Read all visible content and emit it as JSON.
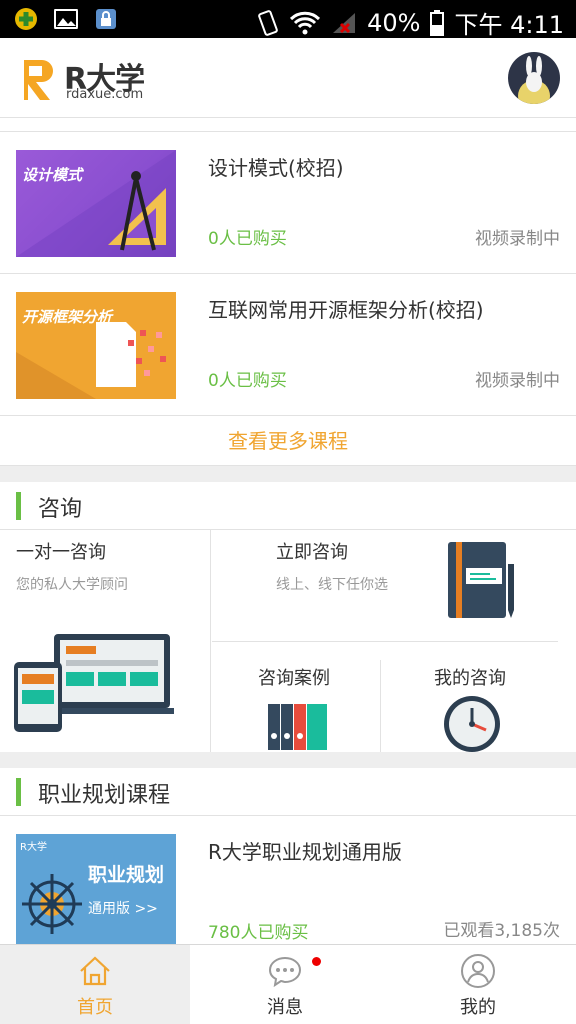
{
  "status_bar": {
    "battery": "40%",
    "time": "下午 4:11"
  },
  "header": {
    "logo_title": "R大学",
    "logo_sub": "rdaxue.com"
  },
  "courses": [
    {
      "title": "设计模式(校招)",
      "thumb_label": "设计模式",
      "bought": "0人已购买",
      "status": "视频录制中"
    },
    {
      "title": "互联网常用开源框架分析(校招)",
      "thumb_label": "开源框架分析",
      "bought": "0人已购买",
      "status": "视频录制中"
    }
  ],
  "more_courses": "查看更多课程",
  "consult": {
    "title": "咨询",
    "one_on_one": {
      "title": "一对一咨询",
      "subtitle": "您的私人大学顾问"
    },
    "instant": {
      "title": "立即咨询",
      "subtitle": "线上、线下任你选"
    },
    "cases": {
      "title": "咨询案例"
    },
    "mine": {
      "title": "我的咨询"
    }
  },
  "career": {
    "title": "职业规划课程",
    "course": {
      "title": "R大学职业规划通用版",
      "bought": "780人已购买",
      "views": "已观看3,185次",
      "thumb_brand": "R大学",
      "thumb_title": "职业规划",
      "thumb_sub": "通用版 >>"
    }
  },
  "nav": {
    "home": "首页",
    "messages": "消息",
    "mine": "我的"
  },
  "colors": {
    "accent": "#f0a531",
    "green": "#6abf45",
    "active_tab_bg": "#eeeeee"
  }
}
